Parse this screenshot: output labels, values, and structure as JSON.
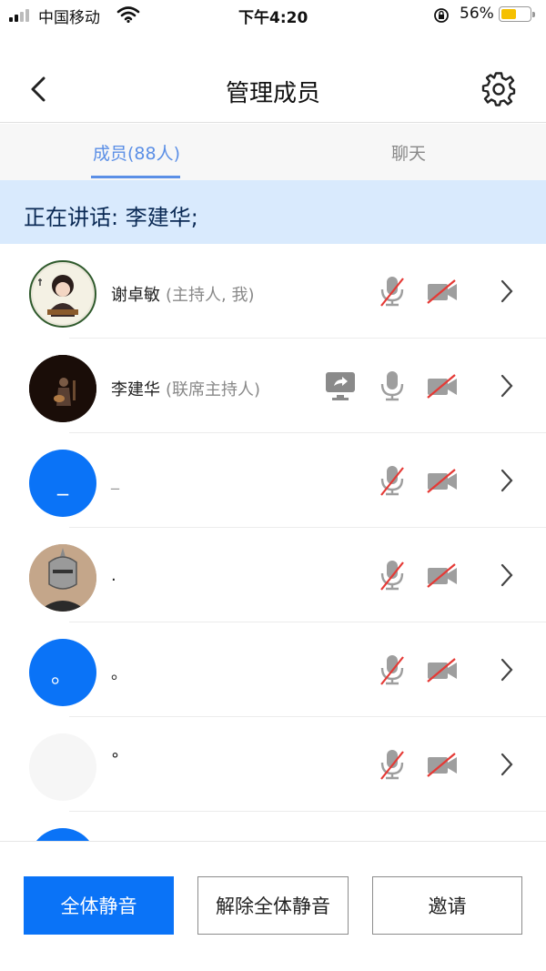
{
  "status_bar": {
    "carrier": "中国移动",
    "time": "下午4:20",
    "battery": "56%",
    "battery_level": 0.56
  },
  "header": {
    "title": "管理成员"
  },
  "tabs": [
    {
      "label": "成员(88人)"
    },
    {
      "label": "聊天"
    }
  ],
  "speaking": "正在讲话: 李建华;",
  "members": [
    {
      "name": "谢卓敏",
      "role": "(主持人, 我)",
      "avatar": "anime-character-avatar",
      "mic": "muted",
      "camera": "off",
      "sharing": false
    },
    {
      "name": "李建华",
      "role": "(联席主持人)",
      "avatar": "guitar-performer-avatar",
      "mic": "on",
      "camera": "off",
      "sharing": true
    },
    {
      "name": "_",
      "role": "",
      "avatar_text": "_",
      "mic": "muted",
      "camera": "off",
      "sharing": false
    },
    {
      "name": ".",
      "role": "",
      "avatar": "knight-helmet-avatar",
      "mic": "muted",
      "camera": "off",
      "sharing": false
    },
    {
      "name": "。",
      "role": "",
      "avatar_text": "。",
      "mic": "muted",
      "camera": "off",
      "sharing": false
    },
    {
      "name": "°",
      "role": "",
      "avatar_text": "",
      "mic": "muted",
      "camera": "off",
      "sharing": false
    },
    {
      "name": "",
      "role": "",
      "avatar_text": "",
      "mic": "muted",
      "camera": "off",
      "sharing": false
    }
  ],
  "buttons": {
    "mute_all": "全体静音",
    "unmute_all": "解除全体静音",
    "invite": "邀请"
  },
  "colors": {
    "accent": "#0a73f7",
    "tab_active": "#5b8fe6",
    "speaking_bg": "#d9eafd",
    "muted_red": "#e53935"
  }
}
